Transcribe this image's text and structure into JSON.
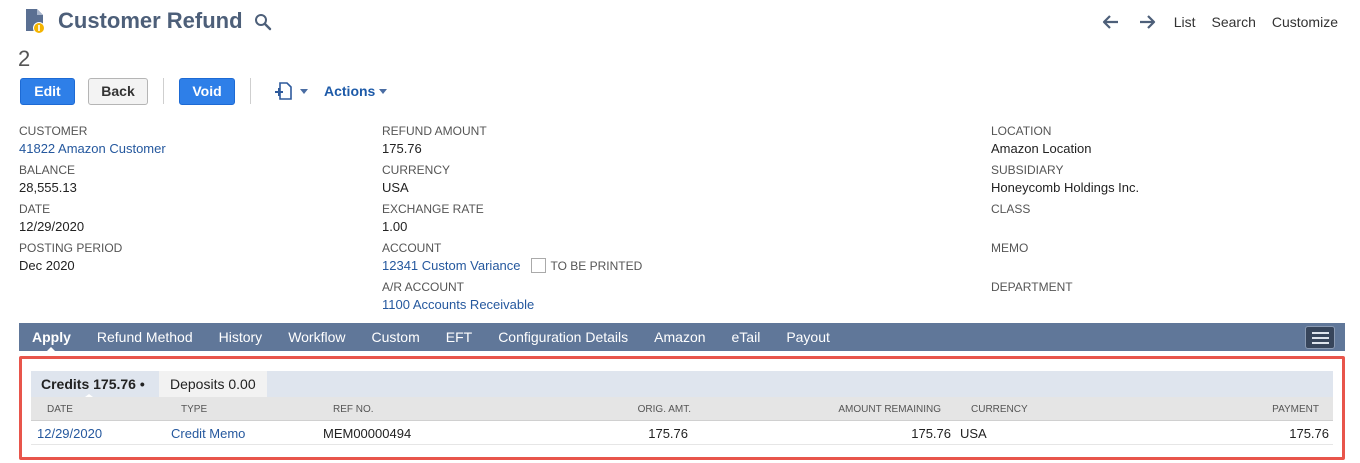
{
  "header": {
    "title": "Customer Refund",
    "record_number": "2",
    "nav_links": [
      "List",
      "Search",
      "Customize"
    ]
  },
  "buttons": {
    "edit": "Edit",
    "back": "Back",
    "void": "Void",
    "actions": "Actions"
  },
  "fields": {
    "customer": {
      "label": "CUSTOMER",
      "value": "41822 Amazon Customer"
    },
    "balance": {
      "label": "BALANCE",
      "value": "28,555.13"
    },
    "date": {
      "label": "DATE",
      "value": "12/29/2020"
    },
    "posting_period": {
      "label": "POSTING PERIOD",
      "value": "Dec 2020"
    },
    "refund_amount": {
      "label": "REFUND AMOUNT",
      "value": "175.76"
    },
    "currency": {
      "label": "CURRENCY",
      "value": "USA"
    },
    "exchange_rate": {
      "label": "EXCHANGE RATE",
      "value": "1.00"
    },
    "account": {
      "label": "ACCOUNT",
      "value": "12341 Custom Variance",
      "checkbox_label": "TO BE PRINTED"
    },
    "ar_account": {
      "label": "A/R ACCOUNT",
      "value": "1100 Accounts Receivable"
    },
    "location": {
      "label": "LOCATION",
      "value": "Amazon Location"
    },
    "subsidiary": {
      "label": "SUBSIDIARY",
      "value": "Honeycomb Holdings Inc."
    },
    "class": {
      "label": "CLASS",
      "value": ""
    },
    "memo": {
      "label": "MEMO",
      "value": ""
    },
    "department": {
      "label": "DEPARTMENT",
      "value": ""
    }
  },
  "tabs": [
    "Apply",
    "Refund Method",
    "History",
    "Workflow",
    "Custom",
    "EFT",
    "Configuration Details",
    "Amazon",
    "eTail",
    "Payout"
  ],
  "sublist": {
    "tabs": {
      "credits": "Credits 175.76 •",
      "deposits": "Deposits 0.00"
    },
    "columns": [
      "DATE",
      "TYPE",
      "REF NO.",
      "ORIG. AMT.",
      "AMOUNT REMAINING",
      "CURRENCY",
      "PAYMENT"
    ],
    "rows": [
      {
        "date": "12/29/2020",
        "type": "Credit Memo",
        "ref_no": "MEM00000494",
        "orig_amt": "175.76",
        "amount_remaining": "175.76",
        "currency": "USA",
        "payment": "175.76"
      }
    ]
  },
  "colors": {
    "accent": "#2e7fe8",
    "tabbar": "#607799",
    "highlight": "#e8554b",
    "link": "#25589e"
  }
}
